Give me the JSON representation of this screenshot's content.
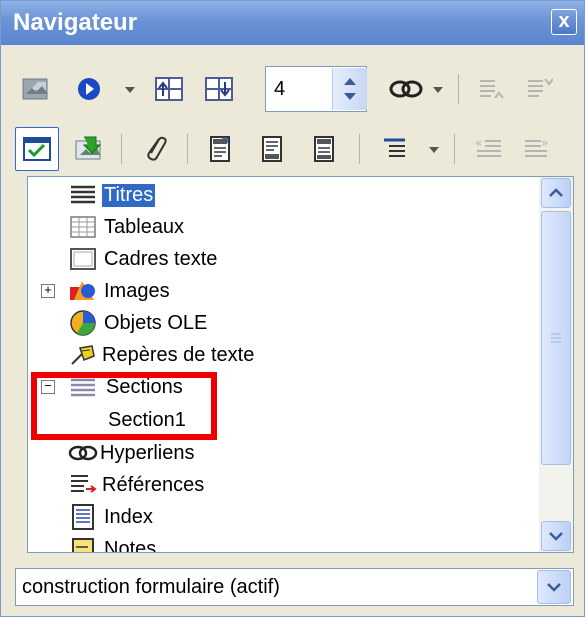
{
  "window": {
    "title": "Navigateur",
    "close_glyph": "x"
  },
  "toolbar": {
    "row1_icons": [
      "toggle-content-icon",
      "navigation-icon",
      "previous-icon",
      "next-icon",
      "page-spin",
      "drag-mode-icon",
      "promote-level-icon",
      "demote-level-icon"
    ],
    "page_number": "4",
    "row2_icons": [
      "list-box-toggle-icon",
      "content-view-icon",
      "set-reminder-icon",
      "header-icon",
      "footer-icon",
      "anchor-icon",
      "heading-levels-icon",
      "promote-chapter-icon",
      "demote-chapter-icon"
    ]
  },
  "tree": {
    "items": [
      {
        "label": "Titres",
        "icon": "headings-icon",
        "selected": true
      },
      {
        "label": "Tableaux",
        "icon": "table-icon"
      },
      {
        "label": "Cadres texte",
        "icon": "frame-icon"
      },
      {
        "label": "Images",
        "icon": "images-icon",
        "expander": "+"
      },
      {
        "label": "Objets OLE",
        "icon": "ole-object-icon"
      },
      {
        "label": "Repères de texte",
        "icon": "bookmark-icon"
      },
      {
        "label": "Sections",
        "icon": "sections-icon",
        "expander": "−"
      },
      {
        "label": "Section1",
        "child": true
      },
      {
        "label": "Hyperliens",
        "icon": "hyperlink-icon"
      },
      {
        "label": "Références",
        "icon": "references-icon"
      },
      {
        "label": "Index",
        "icon": "index-icon"
      },
      {
        "label": "Notes",
        "icon": "notes-icon"
      }
    ]
  },
  "document_select": {
    "value": "construction formulaire (actif)"
  },
  "colors": {
    "titlebar": "#6a93d6",
    "selection": "#316ac5",
    "highlight_box": "#ee0000",
    "panel_bg": "#ece9d8"
  }
}
